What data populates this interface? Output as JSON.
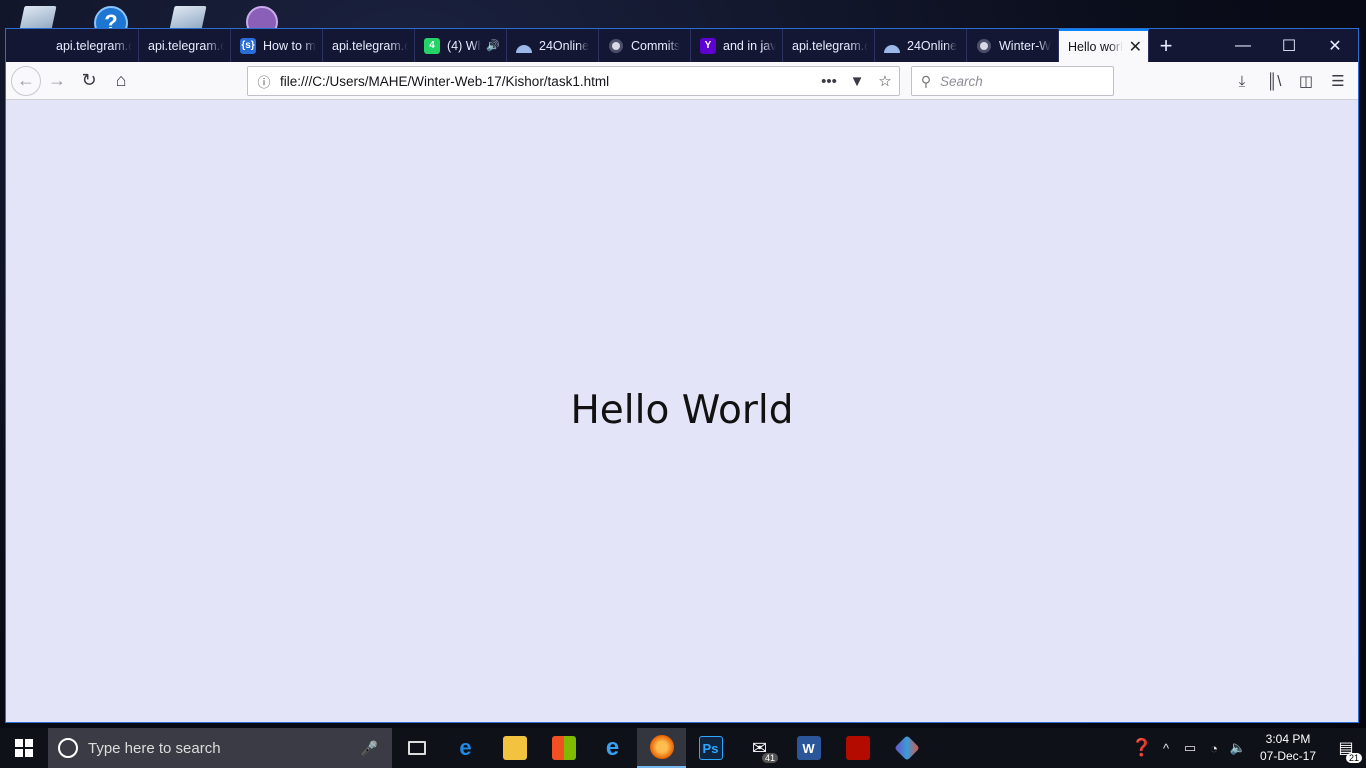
{
  "desktop": {
    "icons": [
      "note-icon",
      "help-icon",
      "note-icon",
      "github-icon"
    ]
  },
  "browser": {
    "tabs": [
      {
        "label": "api.telegram.o",
        "icon": "none"
      },
      {
        "label": "api.telegram.o",
        "icon": "none"
      },
      {
        "label": "How to m",
        "icon": "codepen-icon"
      },
      {
        "label": "api.telegram.o",
        "icon": "none"
      },
      {
        "label": "(4) Wh",
        "icon": "whatsapp-icon"
      },
      {
        "label": "24Online",
        "icon": "speedometer-icon"
      },
      {
        "label": "Commits",
        "icon": "github-icon"
      },
      {
        "label": "and in jav",
        "icon": "yahoo-icon"
      },
      {
        "label": "api.telegram.o",
        "icon": "none"
      },
      {
        "label": "24Online",
        "icon": "speedometer-icon"
      },
      {
        "label": "Winter-W",
        "icon": "github-icon"
      },
      {
        "label": "Hello worl",
        "icon": "none",
        "active": true
      }
    ],
    "whatsapp_badge": "4",
    "yahoo_glyph": "Y",
    "codepen_glyph": "{s}",
    "url": "file:///C:/Users/MAHE/Winter-Web-17/Kishor/task1.html",
    "search_placeholder": "Search"
  },
  "page": {
    "heading": "Hello World"
  },
  "taskbar": {
    "search_placeholder": "Type here to search",
    "mail_badge": "41",
    "photoshop_label": "Ps",
    "word_label": "W",
    "time": "3:04 PM",
    "date": "07-Dec-17",
    "notification_count": "21"
  },
  "colors": {
    "tabstrip": "#131734",
    "page_background": "#e4e4f8",
    "active_tab_accent": "#0a84ff",
    "taskbar": "#0f1119"
  }
}
